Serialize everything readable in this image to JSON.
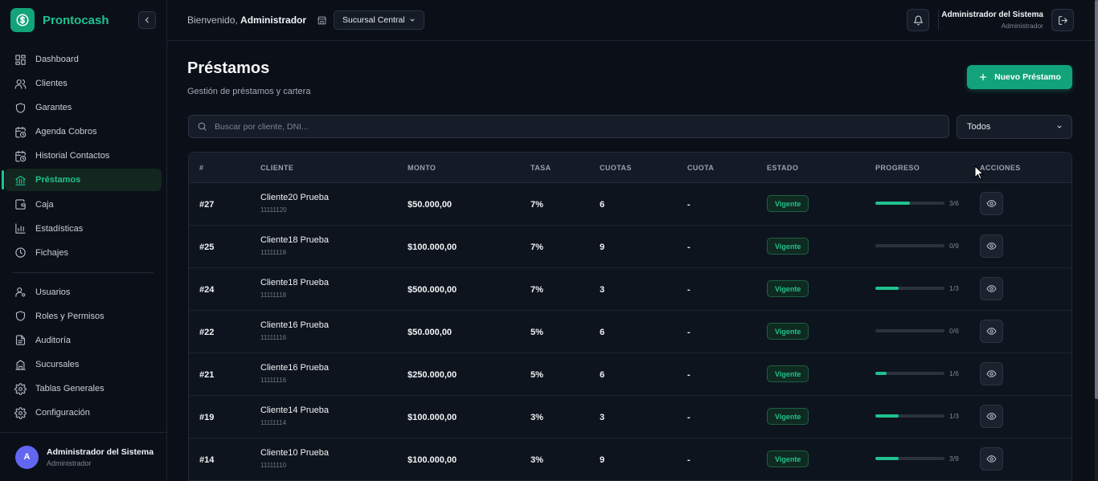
{
  "app": {
    "brand": "Prontocash"
  },
  "sidebar": {
    "items": [
      {
        "label": "Dashboard",
        "icon": "dashboard-icon"
      },
      {
        "label": "Clientes",
        "icon": "users-icon"
      },
      {
        "label": "Garantes",
        "icon": "shield-icon"
      },
      {
        "label": "Agenda Cobros",
        "icon": "calendar-clock-icon"
      },
      {
        "label": "Historial Contactos",
        "icon": "calendar-clock-icon"
      },
      {
        "label": "Préstamos",
        "icon": "bank-icon",
        "active": true
      },
      {
        "label": "Caja",
        "icon": "wallet-icon"
      },
      {
        "label": "Estadísticas",
        "icon": "bar-chart-icon"
      },
      {
        "label": "Fichajes",
        "icon": "clock-icon"
      }
    ],
    "admin_items": [
      {
        "label": "Usuarios",
        "icon": "user-gear-icon"
      },
      {
        "label": "Roles y Permisos",
        "icon": "shield-icon"
      },
      {
        "label": "Auditoría",
        "icon": "document-icon"
      },
      {
        "label": "Sucursales",
        "icon": "building-icon"
      },
      {
        "label": "Tablas Generales",
        "icon": "gear-icon"
      },
      {
        "label": "Configuración",
        "icon": "gear-icon"
      }
    ],
    "user": {
      "initial": "A",
      "name": "Administrador del Sistema",
      "role": "Administrador"
    }
  },
  "topbar": {
    "welcome_prefix": "Bienvenido, ",
    "welcome_name": "Administrador",
    "branch": "Sucursal Central",
    "user_name": "Administrador del Sistema",
    "user_role": "Administrador"
  },
  "page": {
    "title": "Préstamos",
    "subtitle": "Gestión de préstamos y cartera",
    "new_button": "Nuevo Préstamo",
    "search_placeholder": "Buscar por cliente, DNI...",
    "filter_value": "Todos"
  },
  "table": {
    "headers": [
      "#",
      "CLIENTE",
      "MONTO",
      "TASA",
      "CUOTAS",
      "CUOTA",
      "ESTADO",
      "PROGRESO",
      "ACCIONES"
    ],
    "rows": [
      {
        "id": "#27",
        "client": "Cliente20 Prueba",
        "dni": "11111120",
        "monto": "$50.000,00",
        "tasa": "7%",
        "cuotas": "6",
        "cuota": "-",
        "estado": "Vigente",
        "paid": 3,
        "total": 6,
        "progress_text": "3/6"
      },
      {
        "id": "#25",
        "client": "Cliente18 Prueba",
        "dni": "11111118",
        "monto": "$100.000,00",
        "tasa": "7%",
        "cuotas": "9",
        "cuota": "-",
        "estado": "Vigente",
        "paid": 0,
        "total": 9,
        "progress_text": "0/9"
      },
      {
        "id": "#24",
        "client": "Cliente18 Prueba",
        "dni": "11111118",
        "monto": "$500.000,00",
        "tasa": "7%",
        "cuotas": "3",
        "cuota": "-",
        "estado": "Vigente",
        "paid": 1,
        "total": 3,
        "progress_text": "1/3"
      },
      {
        "id": "#22",
        "client": "Cliente16 Prueba",
        "dni": "11111116",
        "monto": "$50.000,00",
        "tasa": "5%",
        "cuotas": "6",
        "cuota": "-",
        "estado": "Vigente",
        "paid": 0,
        "total": 6,
        "progress_text": "0/6"
      },
      {
        "id": "#21",
        "client": "Cliente16 Prueba",
        "dni": "11111116",
        "monto": "$250.000,00",
        "tasa": "5%",
        "cuotas": "6",
        "cuota": "-",
        "estado": "Vigente",
        "paid": 1,
        "total": 6,
        "progress_text": "1/6"
      },
      {
        "id": "#19",
        "client": "Cliente14 Prueba",
        "dni": "11111114",
        "monto": "$100.000,00",
        "tasa": "3%",
        "cuotas": "3",
        "cuota": "-",
        "estado": "Vigente",
        "paid": 1,
        "total": 3,
        "progress_text": "1/3"
      },
      {
        "id": "#14",
        "client": "Cliente10 Prueba",
        "dni": "11111110",
        "monto": "$100.000,00",
        "tasa": "3%",
        "cuotas": "9",
        "cuota": "-",
        "estado": "Vigente",
        "paid": 3,
        "total": 9,
        "progress_text": "3/9"
      }
    ]
  },
  "colors": {
    "accent": "#1fc28f",
    "accent_dark": "#12a37a",
    "background": "#0b1018",
    "avatar": "#6366f1"
  }
}
